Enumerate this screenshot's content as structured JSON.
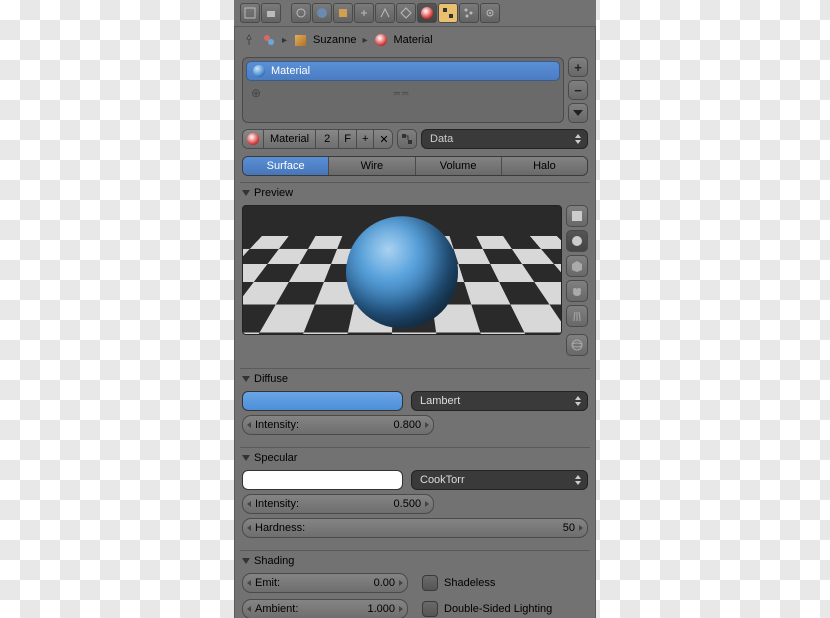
{
  "breadcrumb": {
    "object": "Suzanne",
    "material": "Material"
  },
  "slot": {
    "name": "Material"
  },
  "datablock": {
    "name": "Material",
    "users": "2",
    "fake": "F",
    "node_label": "Data"
  },
  "type_tabs": {
    "surface": "Surface",
    "wire": "Wire",
    "volume": "Volume",
    "halo": "Halo"
  },
  "sections": {
    "preview": "Preview",
    "diffuse": "Diffuse",
    "specular": "Specular",
    "shading": "Shading"
  },
  "diffuse": {
    "shader": "Lambert",
    "intensity_label": "Intensity:",
    "intensity_value": "0.800"
  },
  "specular": {
    "shader": "CookTorr",
    "intensity_label": "Intensity:",
    "intensity_value": "0.500",
    "hardness_label": "Hardness:",
    "hardness_value": "50"
  },
  "shading": {
    "emit_label": "Emit:",
    "emit_value": "0.00",
    "ambient_label": "Ambient:",
    "ambient_value": "1.000",
    "shadeless": "Shadeless",
    "double_sided": "Double-Sided Lighting"
  }
}
